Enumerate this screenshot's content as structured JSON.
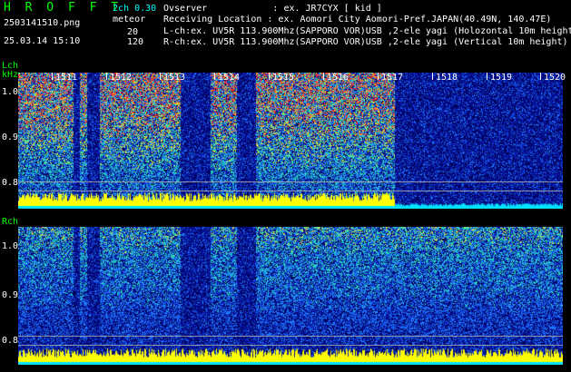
{
  "header": {
    "title": "H R O F F T",
    "filename": "2503141510.png",
    "datetime": "25.03.14 15:10",
    "mode": "2ch 0.30",
    "meteor_label": "meteor",
    "meteor_l": "20",
    "meteor_r": "120",
    "observer": "Ovserver            : ex. JR7CYX [ kid ]",
    "location": "Receiving Location : ex. Aomori City Aomori-Pref.JAPAN(40.49N, 140.47E)",
    "lch": "L-ch:ex. UV5R 113.900Mhz(SAPPORO VOR)USB ,2-ele yagi (Holozontal 10m height)",
    "rch": "R-ch:ex. UV5R 113.900Mhz(SAPPORO VOR)USB ,2-ele yagi (Vertical 10m height)"
  },
  "lch_panel": {
    "label": "Lch",
    "unit": "kHz",
    "y_ticks": [
      "1.0",
      "0.9",
      "0.8"
    ],
    "time_ticks": [
      "1511",
      "1512",
      "1513",
      "1514",
      "1515",
      "1516",
      "1517",
      "1518",
      "1519",
      "1520"
    ]
  },
  "rch_panel": {
    "label": "Rch",
    "y_ticks": [
      "1.0",
      "0.9",
      "0.8"
    ]
  }
}
